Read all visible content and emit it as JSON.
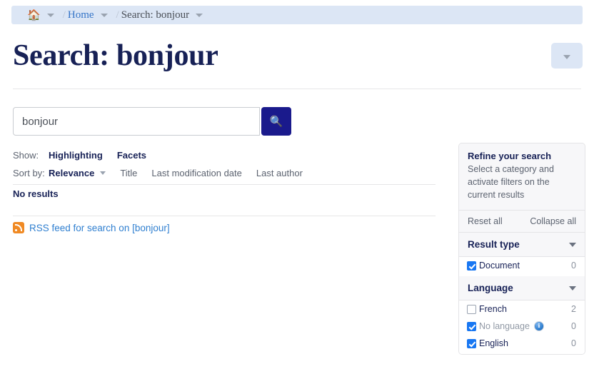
{
  "breadcrumb": {
    "home_icon": "home-icon",
    "separator": "/",
    "home_label": "Home",
    "current_label": "Search: bonjour"
  },
  "header": {
    "title": "Search: bonjour",
    "menu_icon": "chevron-down-icon"
  },
  "search": {
    "value": "bonjour",
    "placeholder": "",
    "button_icon": "🔍"
  },
  "options": {
    "show_label": "Show:",
    "show_items": [
      "Highlighting",
      "Facets"
    ],
    "sort_label": "Sort by:",
    "sort_active": "Relevance",
    "sort_items": [
      "Title",
      "Last modification date",
      "Last author"
    ]
  },
  "results": {
    "empty_message": "No results",
    "rss_label": "RSS feed for search on [bonjour]",
    "rss_icon": "rss-icon"
  },
  "facets": {
    "title": "Refine your search",
    "description": "Select a category and activate filters on the current results",
    "reset_label": "Reset all",
    "collapse_label": "Collapse all",
    "sections": [
      {
        "title": "Result type",
        "items": [
          {
            "label": "Document",
            "checked": true,
            "count": "0",
            "muted": false,
            "info": false
          }
        ]
      },
      {
        "title": "Language",
        "items": [
          {
            "label": "French",
            "checked": false,
            "count": "2",
            "muted": false,
            "info": false
          },
          {
            "label": "No language",
            "checked": true,
            "count": "0",
            "muted": true,
            "info": true
          },
          {
            "label": "English",
            "checked": true,
            "count": "0",
            "muted": false,
            "info": false
          }
        ]
      }
    ]
  },
  "colors": {
    "brand_navy": "#172156",
    "button_navy": "#1a1a8c",
    "link_blue": "#2f7fd0",
    "checkbox_blue": "#1877f2",
    "breadcrumb_bg": "#dce6f5",
    "rss_orange": "#f08a24"
  }
}
